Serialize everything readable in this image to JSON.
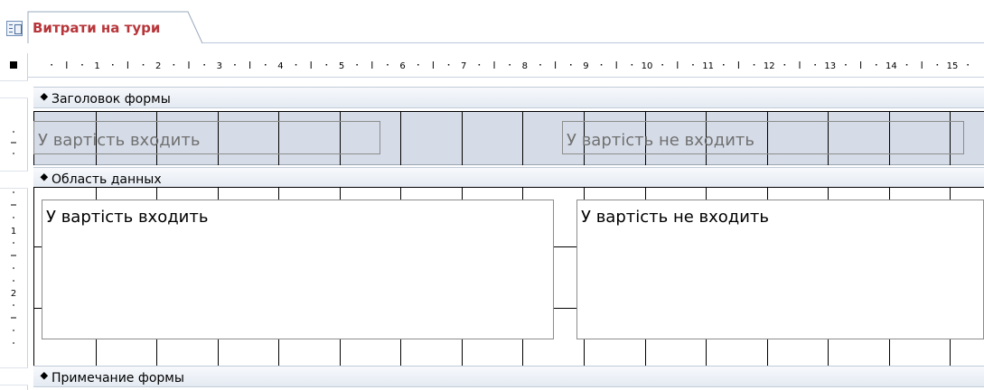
{
  "tab": {
    "title": "Витрати на тури",
    "icon": "form-icon",
    "accent": "#b7363b"
  },
  "ruler": {
    "horizontal_labels": [
      "1",
      "2",
      "3",
      "4",
      "5",
      "6",
      "7",
      "8",
      "9",
      "10",
      "11",
      "12",
      "13",
      "14",
      "15"
    ],
    "vertical_labels": [
      "1",
      "2"
    ]
  },
  "sections": {
    "header": {
      "label": "Заголовок формы"
    },
    "detail": {
      "label": "Область данных"
    },
    "footer": {
      "label": "Примечание формы"
    }
  },
  "controls": {
    "header_included": "У вартість входить",
    "header_not_included": "У вартість не входить",
    "detail_included": "У вартість входить",
    "detail_not_included": "У вартість не входить"
  },
  "colors": {
    "header_background": "#d5dce7",
    "section_bar": "#e4eaf2",
    "tab_text": "#b7363b"
  }
}
